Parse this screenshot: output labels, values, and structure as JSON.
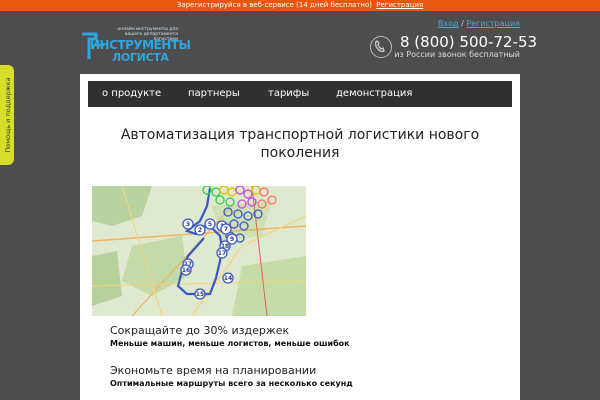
{
  "topbar": {
    "text": "Зарегистрируйся в веб-сервисе (14 дней бесплатно)",
    "link": "Регистрация",
    "color": "#e8560f"
  },
  "logo": {
    "tagline": "онлайн инструменты для вашего департамента логистики",
    "word1": "ИНСТРУМЕНТЫ",
    "word2": "ЛОГИСТА"
  },
  "auth": {
    "login": "Вход",
    "separator": "/",
    "register": "Регистрация"
  },
  "contact": {
    "icon": "phone-icon",
    "phone": "8 (800) 500-72-53",
    "note": "из России звонок бесплатный"
  },
  "nav": {
    "items": [
      "о продукте",
      "партнеры",
      "тарифы",
      "демонстрация"
    ]
  },
  "hero": {
    "title": "Автоматизация транспортной логистики нового поколения"
  },
  "map": {
    "markers": [
      "1",
      "2",
      "3",
      "5",
      "7",
      "9",
      "14",
      "15",
      "16",
      "17",
      "18"
    ]
  },
  "features": [
    {
      "title": "Сокращайте до 30% издержек",
      "subtitle": "Меньше машин, меньше логистов, меньше ошибок"
    },
    {
      "title": "Экономьте время на планировании",
      "subtitle": "Оптимальные маршруты всего за несколько секунд"
    }
  ],
  "support": {
    "label": "Помощь и поддержка"
  }
}
